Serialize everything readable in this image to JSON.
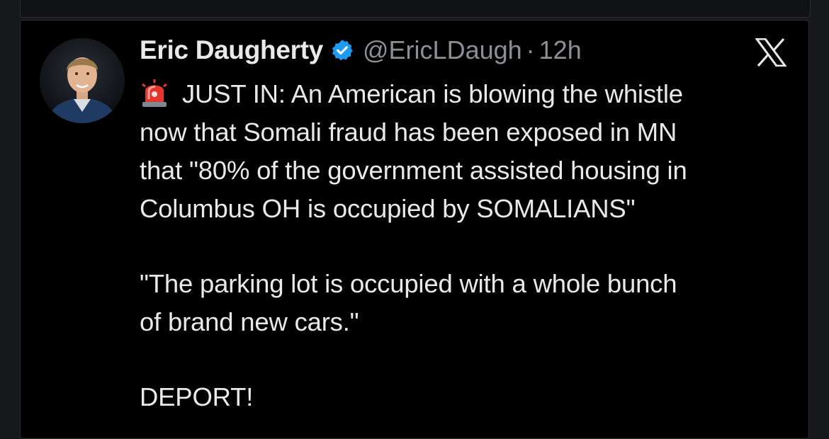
{
  "tweet": {
    "author_name": "Eric Daugherty",
    "handle": "@EricLDaugh",
    "separator": "·",
    "time": "12h",
    "lines": [
      "JUST IN: An American is blowing the whistle",
      "now that Somali fraud has been exposed in MN",
      "that \"80% of the government assisted housing in",
      "Columbus OH is occupied by SOMALIANS\""
    ],
    "quote_lines": [
      "\"The parking lot is occupied with a whole bunch",
      "of brand new cars.\""
    ],
    "closing": "DEPORT!"
  },
  "icons": {
    "verified": "verified-badge-icon",
    "siren": "police-siren-emoji-icon",
    "platform": "x-logo-icon"
  },
  "colors": {
    "background": "#000000",
    "text": "#e7e9ea",
    "muted": "#8b9096",
    "verified_blue": "#1d9bf0"
  }
}
